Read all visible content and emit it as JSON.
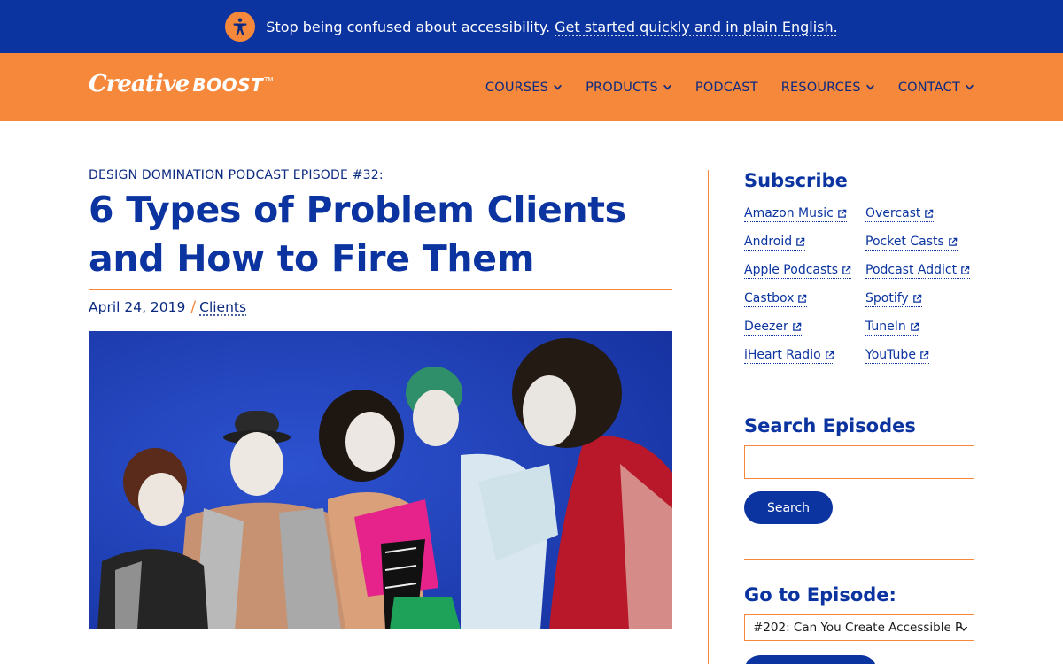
{
  "banner": {
    "text": "Stop being confused about accessibility.",
    "link": "Get started quickly and in plain English.",
    "icon": "accessibility-icon"
  },
  "header": {
    "logo_creative": "Creative",
    "logo_boost": "BOOST",
    "logo_tm": "TM",
    "nav": [
      {
        "label": "COURSES",
        "dropdown": true
      },
      {
        "label": "PRODUCTS",
        "dropdown": true
      },
      {
        "label": "PODCAST",
        "dropdown": false
      },
      {
        "label": "RESOURCES",
        "dropdown": true
      },
      {
        "label": "CONTACT",
        "dropdown": true
      }
    ]
  },
  "article": {
    "kicker": "DESIGN DOMINATION PODCAST EPISODE #32:",
    "title": "6 Types of Problem Clients and How to Fire Them",
    "date": "April 24, 2019",
    "separator": "/",
    "category": "Clients"
  },
  "sidebar": {
    "subscribe_heading": "Subscribe",
    "subscribe_links": [
      "Amazon Music",
      "Overcast",
      "Android",
      "Pocket Casts",
      "Apple Podcasts",
      "Podcast Addict",
      "Castbox",
      "Spotify",
      "Deezer",
      "TuneIn",
      "iHeart Radio",
      "YouTube"
    ],
    "search_heading": "Search Episodes",
    "search_placeholder": "",
    "search_button": "Search",
    "episode_heading": "Go to Episode:",
    "episode_selected": "#202: Can You Create Accessible P"
  },
  "colors": {
    "brand_blue": "#0b34a0",
    "brand_orange": "#f6883c"
  }
}
